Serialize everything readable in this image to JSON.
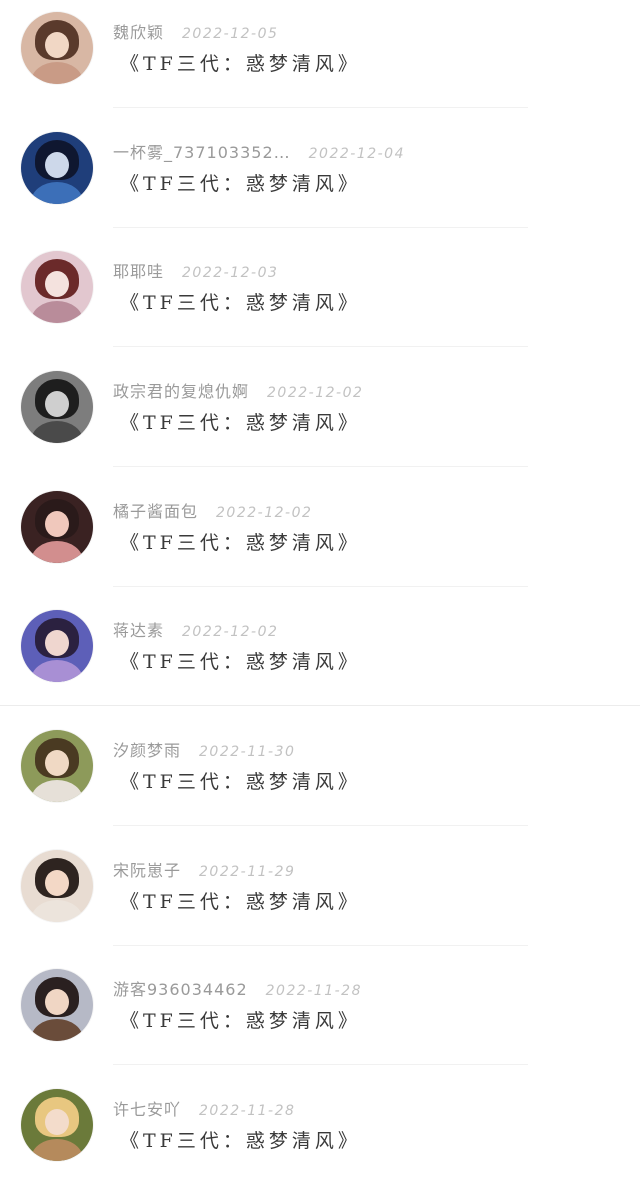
{
  "comments": [
    {
      "username": "魏欣颖",
      "date": "2022-12-05",
      "content": "《TF三代：惑梦清风》",
      "avatar_colors": {
        "bg": "#d8b7a4",
        "hair": "#5a3a2c",
        "face": "#f1d7c5",
        "body": "#c99b86"
      }
    },
    {
      "username": "一杯雾_737103352…",
      "date": "2022-12-04",
      "content": "《TF三代：惑梦清风》",
      "avatar_colors": {
        "bg": "#1f3e7a",
        "hair": "#0f1730",
        "face": "#cdd8ea",
        "body": "#3c6fb8"
      }
    },
    {
      "username": "耶耶哇",
      "date": "2022-12-03",
      "content": "《TF三代：惑梦清风》",
      "avatar_colors": {
        "bg": "#e2c7cf",
        "hair": "#6b2a2a",
        "face": "#f4e2de",
        "body": "#b98c9a"
      }
    },
    {
      "username": "政宗君的复熄仇婀",
      "date": "2022-12-02",
      "content": "《TF三代：惑梦清风》",
      "avatar_colors": {
        "bg": "#7d7d7d",
        "hair": "#1e1e1e",
        "face": "#cfcfcf",
        "body": "#4a4a4a"
      }
    },
    {
      "username": "橘子酱面包",
      "date": "2022-12-02",
      "content": "《TF三代：惑梦清风》",
      "avatar_colors": {
        "bg": "#3a2222",
        "hair": "#2a1a1a",
        "face": "#f0c8bc",
        "body": "#d28e8e"
      }
    },
    {
      "username": "蒋达素",
      "date": "2022-12-02",
      "content": "《TF三代：惑梦清风》",
      "avatar_colors": {
        "bg": "#5d5fb8",
        "hair": "#2b2140",
        "face": "#efd6cf",
        "body": "#a88fd4"
      }
    },
    {
      "username": "汐颜梦雨",
      "date": "2022-11-30",
      "content": "《TF三代：惑梦清风》",
      "avatar_colors": {
        "bg": "#8d9a5a",
        "hair": "#4a3a22",
        "face": "#f0d9c4",
        "body": "#e6e0d8"
      }
    },
    {
      "username": "宋阮崽子",
      "date": "2022-11-29",
      "content": "《TF三代：惑梦清风》",
      "avatar_colors": {
        "bg": "#e8dcd2",
        "hair": "#2e2420",
        "face": "#f3d8c6",
        "body": "#ece4dc"
      }
    },
    {
      "username": "游客936034462",
      "date": "2022-11-28",
      "content": "《TF三代：惑梦清风》",
      "avatar_colors": {
        "bg": "#b6b9c6",
        "hair": "#2a2020",
        "face": "#f0d6c4",
        "body": "#6a4c3a"
      }
    },
    {
      "username": "许七安吖",
      "date": "2022-11-28",
      "content": "《TF三代：惑梦清风》",
      "avatar_colors": {
        "bg": "#6b7a3a",
        "hair": "#e8c780",
        "face": "#f3dccb",
        "body": "#b58a5c"
      }
    }
  ]
}
